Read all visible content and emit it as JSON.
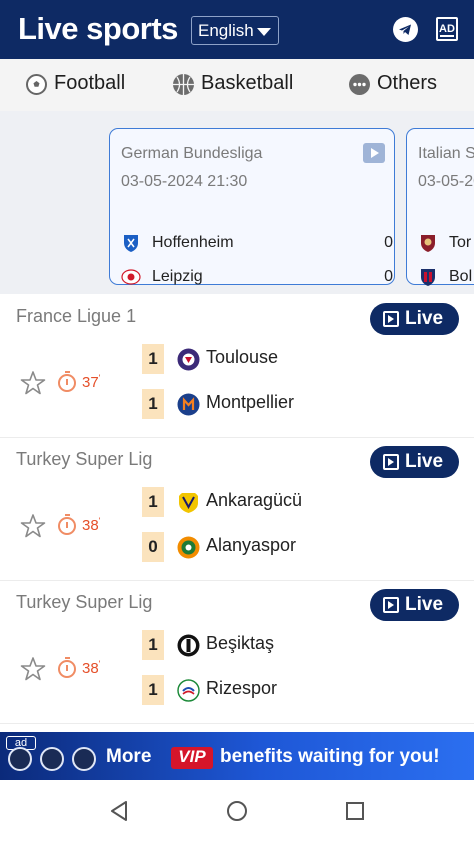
{
  "header": {
    "logo": "Live sports",
    "language": "English",
    "ad_label": "AD"
  },
  "tabs": [
    {
      "label": "Football",
      "icon": "soccer-ball-icon"
    },
    {
      "label": "Basketball",
      "icon": "basketball-icon"
    },
    {
      "label": "Others",
      "icon": "more-dots-icon"
    }
  ],
  "featured": [
    {
      "league": "German Bundesliga",
      "date": "03-05-2024 21:30",
      "home": {
        "name": "Hoffenheim",
        "score": "0"
      },
      "away": {
        "name": "Leipzig",
        "score": "0"
      }
    },
    {
      "league": "Italian S",
      "date": "03-05-20",
      "home": {
        "name": "Tor",
        "score": ""
      },
      "away": {
        "name": "Bol",
        "score": ""
      }
    }
  ],
  "matches": [
    {
      "league": "France Ligue 1",
      "live_label": "Live",
      "minute": "37",
      "home": {
        "name": "Toulouse",
        "score": "1"
      },
      "away": {
        "name": "Montpellier",
        "score": "1"
      }
    },
    {
      "league": "Turkey Super Lig",
      "live_label": "Live",
      "minute": "38",
      "home": {
        "name": "Ankaragücü",
        "score": "1"
      },
      "away": {
        "name": "Alanyaspor",
        "score": "0"
      }
    },
    {
      "league": "Turkey Super Lig",
      "live_label": "Live",
      "minute": "38",
      "home": {
        "name": "Beşiktaş",
        "score": "1"
      },
      "away": {
        "name": "Rizespor",
        "score": "1"
      }
    }
  ],
  "banner": {
    "ad_tag": "ad",
    "more": "More",
    "vip": "VIP",
    "rest": "benefits waiting for you!"
  },
  "colors": {
    "header_bg": "#0e2a64",
    "accent_blue": "#3e7bd6",
    "minute_red": "#e5502a",
    "score_box": "#fbe3bd"
  }
}
